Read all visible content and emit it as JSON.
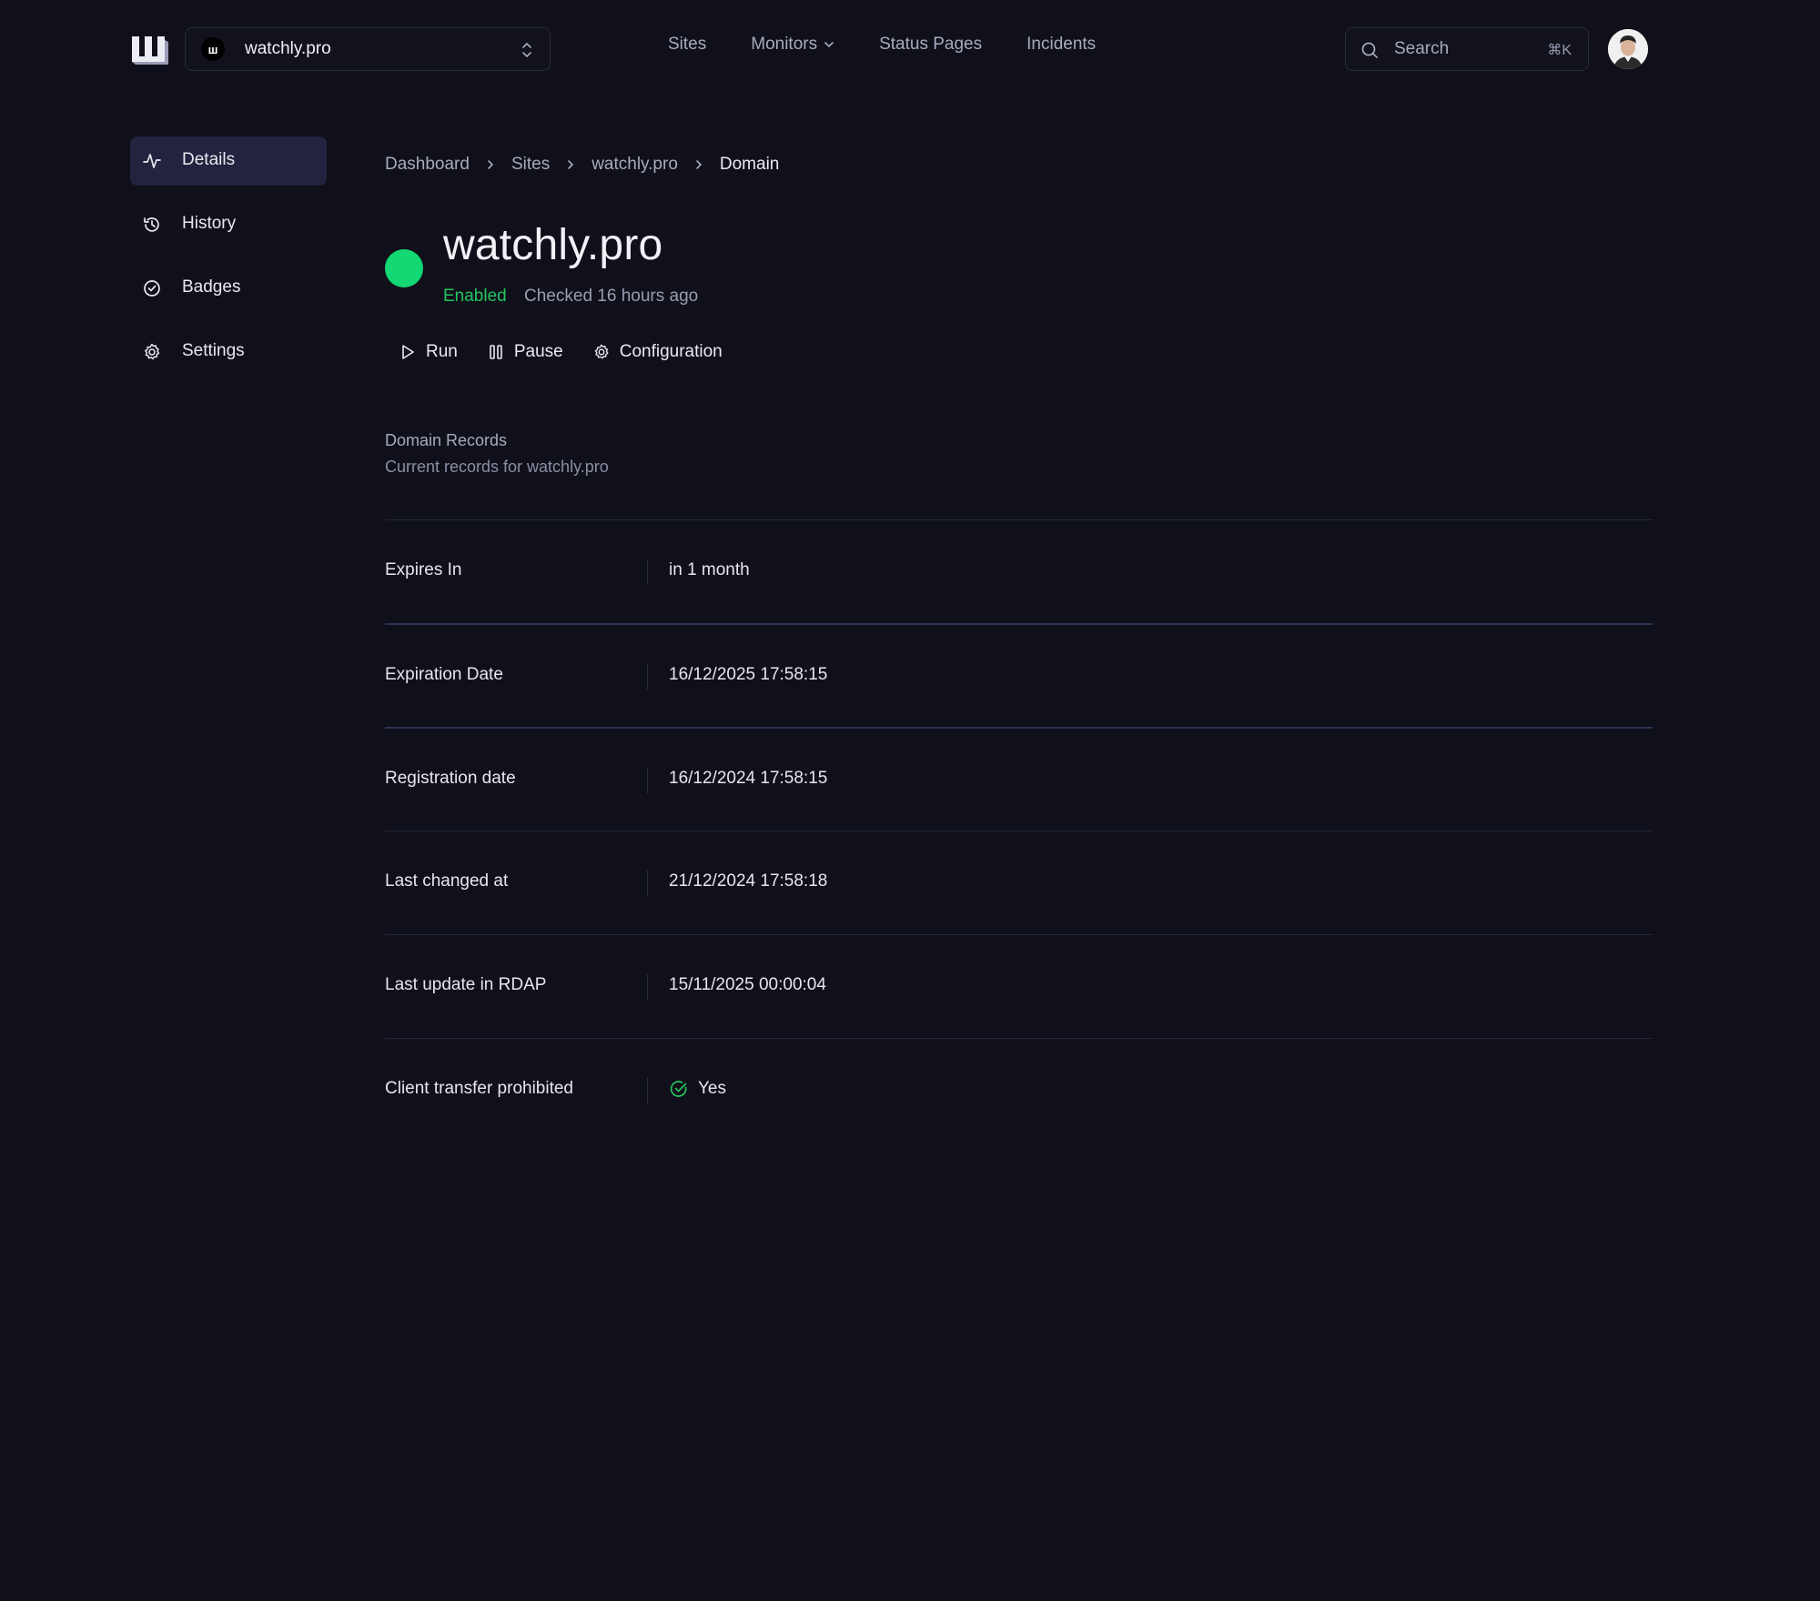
{
  "topbar": {
    "site_switcher": {
      "favicon_glyph": "ш",
      "value": "watchly.pro"
    },
    "nav": [
      {
        "label": "Sites"
      },
      {
        "label": "Monitors"
      },
      {
        "label": "Status Pages"
      },
      {
        "label": "Incidents"
      }
    ],
    "search": {
      "label": "Search",
      "shortcut": "⌘K"
    }
  },
  "sidebar": {
    "items": [
      {
        "label": "Details",
        "icon": "activity-icon",
        "active": true
      },
      {
        "label": "History",
        "icon": "history-icon",
        "active": false
      },
      {
        "label": "Badges",
        "icon": "badge-check-icon",
        "active": false
      },
      {
        "label": "Settings",
        "icon": "gear-icon",
        "active": false
      }
    ]
  },
  "breadcrumb": [
    "Dashboard",
    "Sites",
    "watchly.pro",
    "Domain"
  ],
  "header": {
    "title": "watchly.pro",
    "status": "Enabled",
    "checked": "Checked 16 hours ago",
    "status_color": "#14d873"
  },
  "actions": [
    {
      "label": "Run",
      "icon": "play-icon"
    },
    {
      "label": "Pause",
      "icon": "pause-icon"
    },
    {
      "label": "Configuration",
      "icon": "gear-icon"
    }
  ],
  "section": {
    "title": "Domain Records",
    "subtitle": "Current records for watchly.pro"
  },
  "records": [
    {
      "key": "Expires In",
      "value": "in 1 month"
    },
    {
      "key": "Expiration Date",
      "value": "16/12/2025 17:58:15"
    },
    {
      "key": "Registration date",
      "value": "16/12/2024 17:58:15"
    },
    {
      "key": "Last changed at",
      "value": "21/12/2024 17:58:18"
    },
    {
      "key": "Last update in RDAP",
      "value": "15/11/2025 00:00:04"
    },
    {
      "key": "Client transfer prohibited",
      "value": "Yes"
    }
  ],
  "colors": {
    "background": "#10101b",
    "accent_green": "#22c55e",
    "active_sidebar": "#24233f"
  }
}
